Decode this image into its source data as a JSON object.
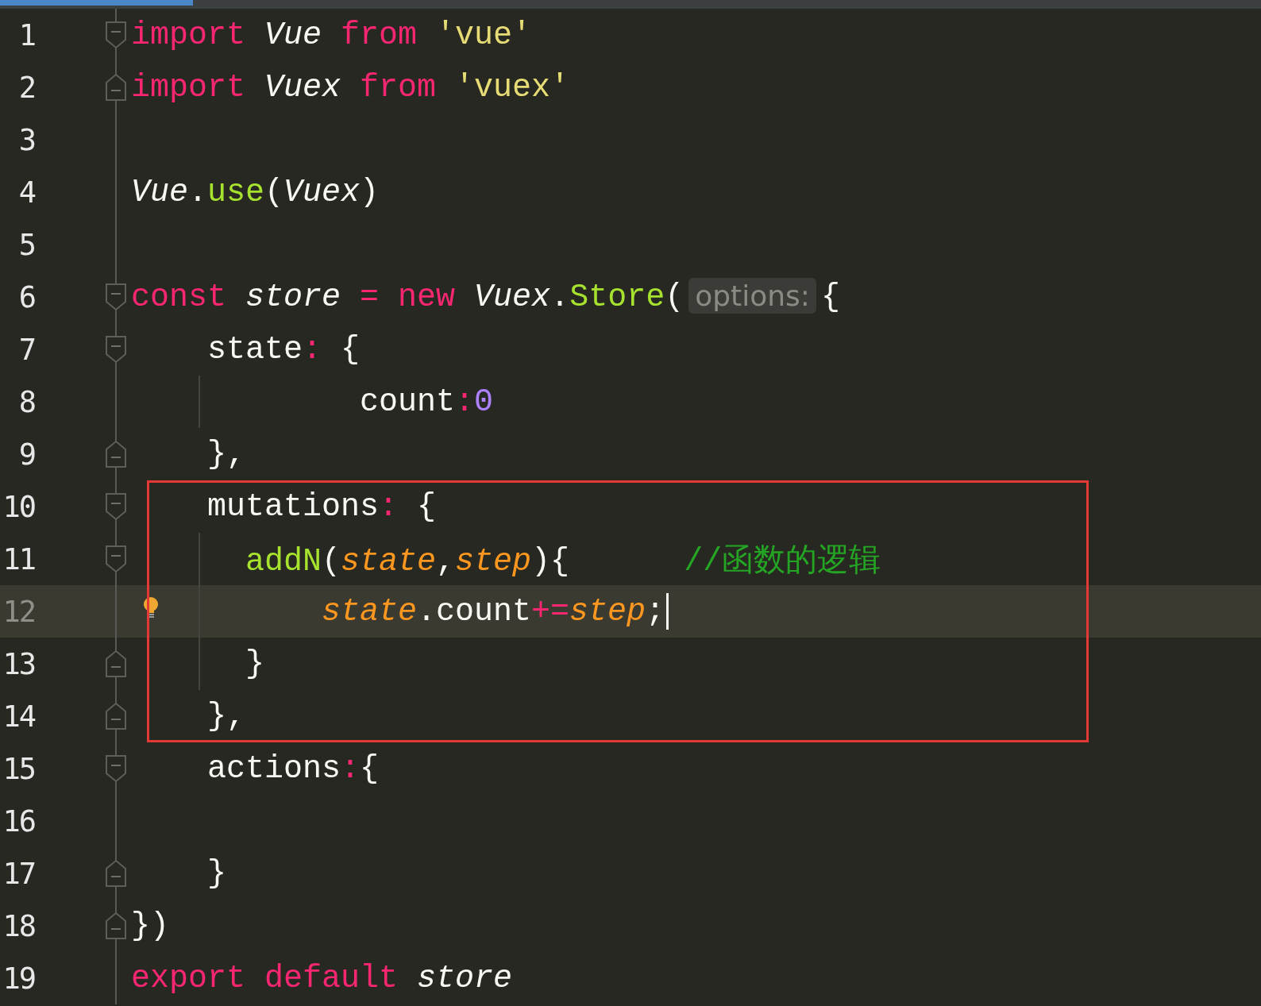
{
  "editor": {
    "lines": [
      {
        "number": "1",
        "fold_open": true,
        "current": false,
        "boxed": false,
        "tokens": [
          {
            "kind": "keyword",
            "text": "import "
          },
          {
            "kind": "class",
            "text": "Vue "
          },
          {
            "kind": "keyword",
            "text": "from "
          },
          {
            "kind": "string",
            "text": "'vue'"
          }
        ]
      },
      {
        "number": "2",
        "fold_open": false,
        "current": false,
        "boxed": false,
        "tokens": [
          {
            "kind": "keyword",
            "text": "import "
          },
          {
            "kind": "class",
            "text": "Vuex "
          },
          {
            "kind": "keyword",
            "text": "from "
          },
          {
            "kind": "string",
            "text": "'vuex'"
          }
        ]
      },
      {
        "number": "3",
        "current": false,
        "boxed": false
      },
      {
        "number": "4",
        "current": false,
        "boxed": false,
        "tokens": [
          {
            "kind": "class",
            "text": "Vue"
          },
          {
            "kind": "plain",
            "text": "."
          },
          {
            "kind": "function",
            "text": "use"
          },
          {
            "kind": "plain",
            "text": "("
          },
          {
            "kind": "class",
            "text": "Vuex"
          },
          {
            "kind": "plain",
            "text": ")"
          }
        ]
      },
      {
        "number": "5",
        "current": false,
        "boxed": false
      },
      {
        "number": "6",
        "fold_open": true,
        "current": false,
        "boxed": false,
        "tokens": [
          {
            "kind": "keyword",
            "text": "const "
          },
          {
            "kind": "class",
            "text": "store "
          },
          {
            "kind": "operator",
            "text": "= "
          },
          {
            "kind": "keyword",
            "text": "new "
          },
          {
            "kind": "class",
            "text": "Vuex"
          },
          {
            "kind": "plain",
            "text": "."
          },
          {
            "kind": "function",
            "text": "Store"
          },
          {
            "kind": "plain",
            "text": "("
          },
          {
            "kind": "hint",
            "text": "options:"
          },
          {
            "kind": "plain",
            "text": "{"
          }
        ]
      },
      {
        "number": "7",
        "fold_open": true,
        "current": false,
        "boxed": false,
        "tokens": [
          {
            "kind": "plain",
            "text": "    state"
          },
          {
            "kind": "operator",
            "text": ":"
          },
          {
            "kind": "plain",
            "text": " {"
          }
        ]
      },
      {
        "number": "8",
        "current": false,
        "boxed": false,
        "tokens": [
          {
            "kind": "plain",
            "text": "            count"
          },
          {
            "kind": "operator",
            "text": ":"
          },
          {
            "kind": "number",
            "text": "0"
          }
        ]
      },
      {
        "number": "9",
        "fold_open": false,
        "current": false,
        "boxed": false,
        "tokens": [
          {
            "kind": "plain",
            "text": "    },"
          }
        ]
      },
      {
        "number": "10",
        "fold_open": true,
        "current": false,
        "boxed": true,
        "tokens": [
          {
            "kind": "plain",
            "text": "    mutations"
          },
          {
            "kind": "operator",
            "text": ":"
          },
          {
            "kind": "plain",
            "text": " {"
          }
        ]
      },
      {
        "number": "11",
        "fold_open": true,
        "current": false,
        "boxed": true,
        "tokens": [
          {
            "kind": "function",
            "text": "      addN"
          },
          {
            "kind": "plain",
            "text": "("
          },
          {
            "kind": "param",
            "text": "state"
          },
          {
            "kind": "plain",
            "text": ","
          },
          {
            "kind": "param",
            "text": "step"
          },
          {
            "kind": "plain",
            "text": "){      "
          },
          {
            "kind": "comment",
            "text": "//函数的逻辑"
          }
        ]
      },
      {
        "number": "12",
        "current": true,
        "boxed": true,
        "tokens": [
          {
            "kind": "param",
            "text": "          state"
          },
          {
            "kind": "plain",
            "text": ".count"
          },
          {
            "kind": "operator",
            "text": "+="
          },
          {
            "kind": "param",
            "text": "step"
          },
          {
            "kind": "plain",
            "text": ";"
          }
        ]
      },
      {
        "number": "13",
        "fold_open": false,
        "current": false,
        "boxed": true,
        "tokens": [
          {
            "kind": "plain",
            "text": "      }"
          }
        ]
      },
      {
        "number": "14",
        "fold_open": false,
        "current": false,
        "boxed": true,
        "tokens": [
          {
            "kind": "plain",
            "text": "    },"
          }
        ]
      },
      {
        "number": "15",
        "fold_open": true,
        "current": false,
        "boxed": false,
        "tokens": [
          {
            "kind": "plain",
            "text": "    actions"
          },
          {
            "kind": "operator",
            "text": ":"
          },
          {
            "kind": "plain",
            "text": "{"
          }
        ]
      },
      {
        "number": "16",
        "current": false,
        "boxed": false
      },
      {
        "number": "17",
        "fold_open": false,
        "current": false,
        "boxed": false,
        "tokens": [
          {
            "kind": "plain",
            "text": "    }"
          }
        ]
      },
      {
        "number": "18",
        "fold_open": false,
        "current": false,
        "boxed": false,
        "tokens": [
          {
            "kind": "plain",
            "text": "})"
          }
        ]
      },
      {
        "number": "19",
        "current": false,
        "boxed": false,
        "tokens": [
          {
            "kind": "keyword",
            "text": "export default "
          },
          {
            "kind": "class",
            "text": "store"
          }
        ]
      }
    ]
  }
}
